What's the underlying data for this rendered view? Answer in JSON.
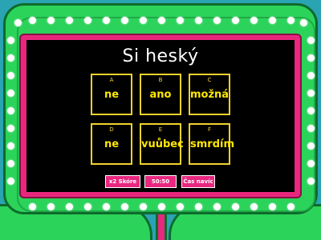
{
  "question": {
    "title": "Si heský"
  },
  "answers": [
    {
      "letter": "A",
      "text": "ne"
    },
    {
      "letter": "B",
      "text": "ano"
    },
    {
      "letter": "C",
      "text": "možná"
    },
    {
      "letter": "D",
      "text": "ne"
    },
    {
      "letter": "E",
      "text": "vuůbec"
    },
    {
      "letter": "F",
      "text": "smrdím"
    }
  ],
  "powerups": {
    "double_score": "x2 Skóre",
    "fifty_fifty": "50:50",
    "extra_time": "Čas navíc"
  },
  "colors": {
    "frame_green": "#2bd35a",
    "panel_pink": "#e8277f",
    "answer_yellow": "#ffe800",
    "background_teal": "#2aa3b3"
  }
}
